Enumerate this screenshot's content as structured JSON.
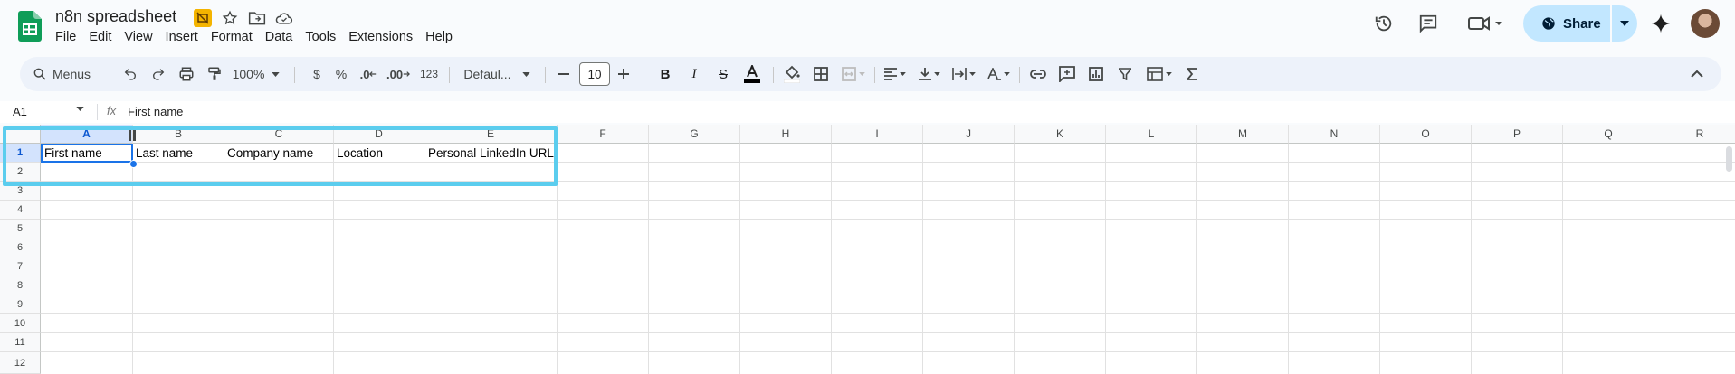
{
  "doc": {
    "title": "n8n spreadsheet",
    "menus": [
      "File",
      "Edit",
      "View",
      "Insert",
      "Format",
      "Data",
      "Tools",
      "Extensions",
      "Help"
    ]
  },
  "actions": {
    "share_label": "Share"
  },
  "toolbar": {
    "search_label": "Menus",
    "zoom": "100%",
    "currency": "$",
    "percent": "%",
    "decrease_decimal": ".0",
    "increase_decimal": ".00",
    "number_format": "123",
    "font": "Defaul...",
    "font_size": "10"
  },
  "formula_bar": {
    "cell_ref": "A1",
    "fx": "fx",
    "value": "First name"
  },
  "sheet": {
    "columns": [
      "A",
      "B",
      "C",
      "D",
      "E",
      "F",
      "G",
      "H",
      "I",
      "J",
      "K",
      "L",
      "M",
      "N",
      "O",
      "P",
      "Q",
      "R"
    ],
    "rows": [
      "1",
      "2",
      "3",
      "4",
      "5",
      "6",
      "7",
      "8",
      "9",
      "10",
      "11",
      "12"
    ],
    "cells": {
      "A1": "First name",
      "B1": "Last name",
      "C1": "Company name",
      "D1": "Location",
      "E1": "Personal LinkedIn URL"
    }
  },
  "colors": {
    "accent": "#1a73e8",
    "highlight": "#5bcdee",
    "share_bg": "#c2e7ff",
    "toolbar_bg": "#edf2fa"
  }
}
